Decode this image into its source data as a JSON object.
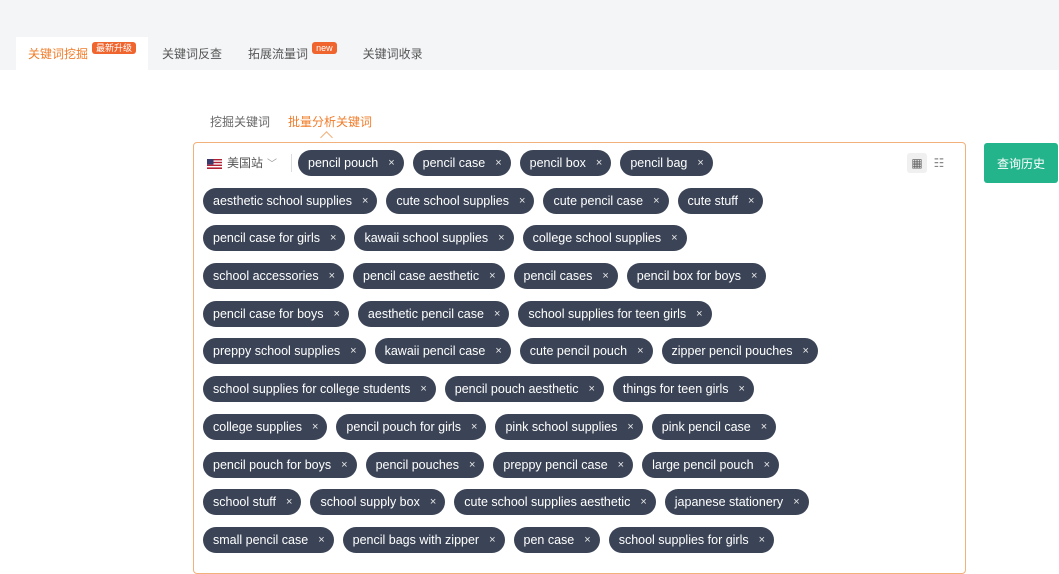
{
  "tabs": [
    {
      "label": "关键词挖掘",
      "badge": "最新升级",
      "active": true
    },
    {
      "label": "关键词反查",
      "badge": "",
      "active": false
    },
    {
      "label": "拓展流量词",
      "badge": "new",
      "active": false
    },
    {
      "label": "关键词收录",
      "badge": "",
      "active": false
    }
  ],
  "subtabs": [
    {
      "label": "挖掘关键词",
      "active": false
    },
    {
      "label": "批量分析关键词",
      "active": true
    }
  ],
  "site_selector": {
    "flag_icon": "us-flag-icon",
    "label": "美国站"
  },
  "history_button": "查询历史",
  "view_icons": [
    "grid-view-icon",
    "list-view-icon"
  ],
  "tag_close_glyph": "×",
  "keyword_rows": [
    [
      "pencil pouch",
      "pencil case",
      "pencil box",
      "pencil bag"
    ],
    [
      "aesthetic school supplies",
      "cute school supplies",
      "cute pencil case",
      "cute stuff"
    ],
    [
      "pencil case for girls",
      "kawaii school supplies",
      "college school supplies"
    ],
    [
      "school accessories",
      "pencil case aesthetic",
      "pencil cases",
      "pencil box for boys"
    ],
    [
      "pencil case for boys",
      "aesthetic pencil case",
      "school supplies for teen girls"
    ],
    [
      "preppy school supplies",
      "kawaii pencil case",
      "cute pencil pouch",
      "zipper pencil pouches"
    ],
    [
      "school supplies for college students",
      "pencil pouch aesthetic",
      "things for teen girls"
    ],
    [
      "college supplies",
      "pencil pouch for girls",
      "pink school supplies",
      "pink pencil case"
    ],
    [
      "pencil pouch for boys",
      "pencil pouches",
      "preppy pencil case",
      "large pencil pouch"
    ],
    [
      "school stuff",
      "school supply box",
      "cute school supplies aesthetic",
      "japanese stationery"
    ],
    [
      "small pencil case",
      "pencil bags with zipper",
      "pen case",
      "school supplies for girls"
    ]
  ],
  "colors": {
    "accent": "#f07c2a",
    "tag_bg": "#3b4456",
    "button_green": "#24b48c",
    "badge_red": "#f0642e"
  }
}
